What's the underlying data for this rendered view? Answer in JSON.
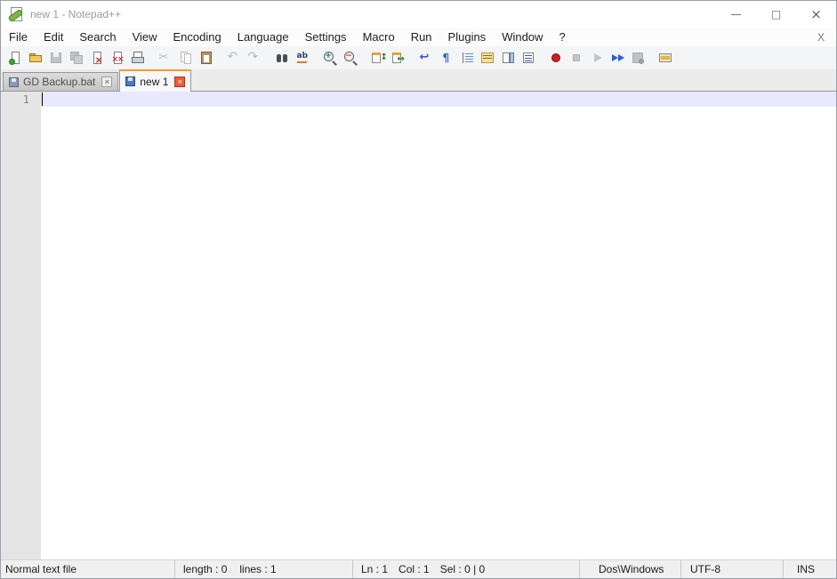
{
  "window": {
    "title": "new 1 - Notepad++",
    "controls": {
      "minimize": "—",
      "maximize": "□",
      "close": "×"
    }
  },
  "menu": {
    "items": [
      "File",
      "Edit",
      "Search",
      "View",
      "Encoding",
      "Language",
      "Settings",
      "Macro",
      "Run",
      "Plugins",
      "Window",
      "?"
    ],
    "doc_close": "X"
  },
  "toolbar": {
    "buttons": [
      {
        "name": "new-file"
      },
      {
        "name": "open-file"
      },
      {
        "name": "save",
        "disabled": true
      },
      {
        "name": "save-all",
        "disabled": true
      },
      {
        "name": "close"
      },
      {
        "name": "close-all"
      },
      {
        "name": "print",
        "sep_after": true
      },
      {
        "name": "cut",
        "disabled": true
      },
      {
        "name": "copy",
        "disabled": true
      },
      {
        "name": "paste",
        "sep_after": true
      },
      {
        "name": "undo",
        "disabled": true
      },
      {
        "name": "redo",
        "disabled": true,
        "sep_after": true
      },
      {
        "name": "find"
      },
      {
        "name": "replace",
        "sep_after": true
      },
      {
        "name": "zoom-in"
      },
      {
        "name": "zoom-out",
        "sep_after": true
      },
      {
        "name": "sync-vertical-scrolling"
      },
      {
        "name": "sync-horizontal-scrolling",
        "sep_after": true
      },
      {
        "name": "word-wrap"
      },
      {
        "name": "show-all-characters"
      },
      {
        "name": "show-indent-guide"
      },
      {
        "name": "function-list"
      },
      {
        "name": "document-map"
      },
      {
        "name": "document-list",
        "sep_after": true
      },
      {
        "name": "macro-start-recording"
      },
      {
        "name": "macro-stop-recording",
        "disabled": true
      },
      {
        "name": "macro-playback",
        "disabled": true
      },
      {
        "name": "macro-run-multiple-times"
      },
      {
        "name": "macro-save",
        "disabled": true,
        "sep_after": true
      },
      {
        "name": "edit-toolbar"
      }
    ]
  },
  "tabs": {
    "close_glyph": "×",
    "items": [
      {
        "label": "GD Backup.bat",
        "active": false
      },
      {
        "label": "new 1",
        "active": true
      }
    ]
  },
  "editor": {
    "line_numbers": [
      "1"
    ],
    "content": ""
  },
  "status_bar": {
    "doc_type": "Normal text file",
    "length": "length : 0",
    "lines": "lines : 1",
    "line": "Ln : 1",
    "column": "Col : 1",
    "selection": "Sel : 0 | 0",
    "eol_format": "Dos\\Windows",
    "encoding": "UTF-8",
    "typing_mode": "INS"
  }
}
